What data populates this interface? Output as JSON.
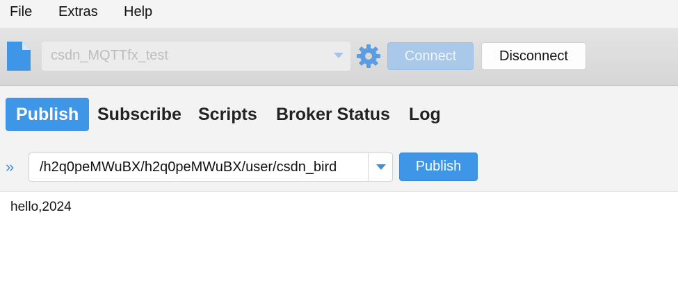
{
  "menu": {
    "items": [
      "File",
      "Extras",
      "Help"
    ]
  },
  "connection": {
    "profile": "csdn_MQTTfx_test",
    "connect_label": "Connect",
    "disconnect_label": "Disconnect",
    "connect_enabled": false
  },
  "tabs": [
    {
      "label": "Publish",
      "active": true
    },
    {
      "label": "Subscribe",
      "active": false
    },
    {
      "label": "Scripts",
      "active": false
    },
    {
      "label": "Broker Status",
      "active": false
    },
    {
      "label": "Log",
      "active": false
    }
  ],
  "publish": {
    "expand_icon": "»",
    "topic": "/h2q0peMWuBX/h2q0peMWuBX/user/csdn_bird",
    "button_label": "Publish",
    "message": "hello,2024"
  },
  "colors": {
    "accent": "#3f96e6",
    "disabled_accent": "#a9c8ea",
    "toolbar": "#dcdcdc"
  },
  "icons": {
    "file": "file-icon",
    "settings": "gear-icon",
    "expand": "double-chevron-right-icon",
    "dropdown": "chevron-down-icon"
  }
}
